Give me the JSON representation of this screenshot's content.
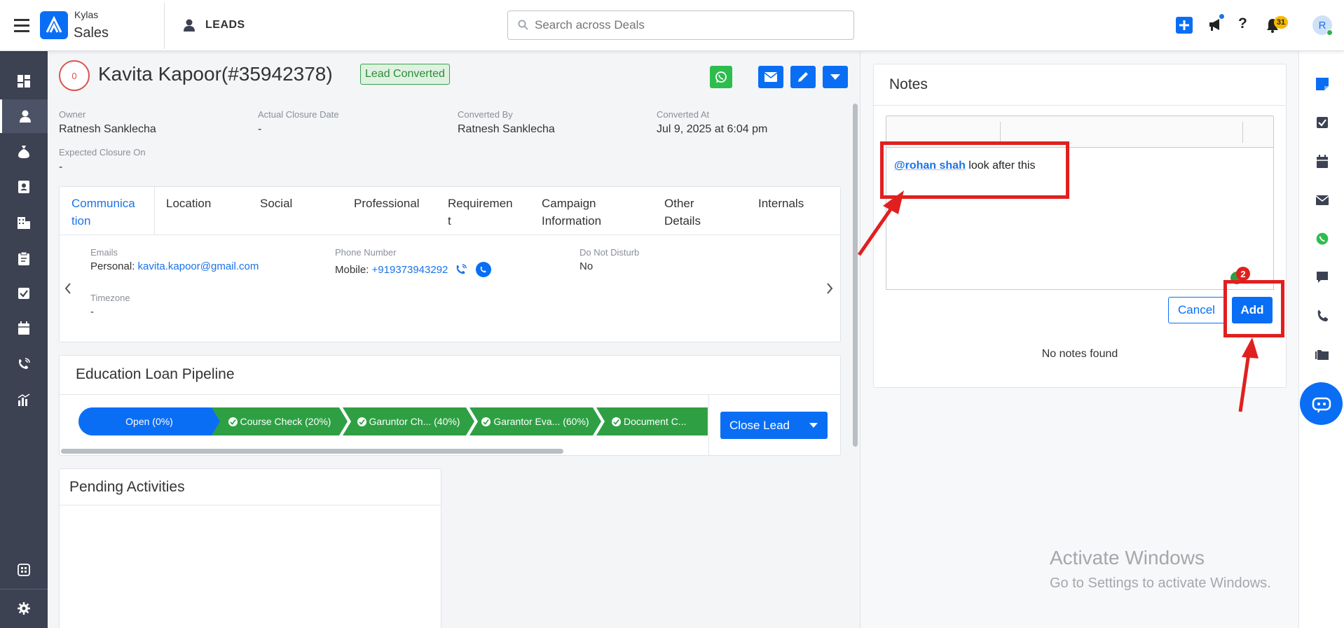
{
  "app": {
    "brand_top": "Kylas",
    "brand_bottom": "Sales",
    "module": "LEADS"
  },
  "search": {
    "placeholder": "Search across Deals"
  },
  "header": {
    "notification_count": "31",
    "avatar_initial": "R"
  },
  "lead": {
    "score": "0",
    "name": "Kavita Kapoor(#35942378)",
    "status": "Lead Converted"
  },
  "fields": [
    {
      "label": "Owner",
      "value": "Ratnesh Sanklecha"
    },
    {
      "label": "Actual Closure Date",
      "value": "-"
    },
    {
      "label": "Converted By",
      "value": "Ratnesh Sanklecha"
    },
    {
      "label": "Converted At",
      "value": "Jul 9, 2025 at 6:04 pm"
    },
    {
      "label": "Expected Closure On",
      "value": "-"
    }
  ],
  "tabs": [
    {
      "l1": "Communica",
      "l2": "tion"
    },
    {
      "l1": "Location",
      "l2": ""
    },
    {
      "l1": "Social",
      "l2": ""
    },
    {
      "l1": "Professional",
      "l2": ""
    },
    {
      "l1": "Requiremen",
      "l2": "t"
    },
    {
      "l1": "Campaign",
      "l2": "Information"
    },
    {
      "l1": "Other",
      "l2": "Details"
    },
    {
      "l1": "Internals",
      "l2": ""
    }
  ],
  "comm": {
    "emails_label": "Emails",
    "email_prefix": "Personal:",
    "email": "kavita.kapoor@gmail.com",
    "phone_label": "Phone Number",
    "phone_prefix": "Mobile:",
    "phone": "+919373943292",
    "dnd_label": "Do Not Disturb",
    "dnd": "No",
    "tz_label": "Timezone",
    "tz": "-"
  },
  "pipeline": {
    "title": "Education Loan Pipeline",
    "stages": [
      "Open (0%)",
      "Course Check (20%)",
      "Garuntor Ch...  (40%)",
      "Garantor Eva... (60%)",
      "Document C..."
    ],
    "close_label": "Close Lead"
  },
  "pending": {
    "title": "Pending Activities"
  },
  "notes": {
    "title": "Notes",
    "block_style": "Paragraph",
    "mention": "@rohan shah",
    "text": " look after this",
    "cancel": "Cancel",
    "add": "Add",
    "empty": "No notes found",
    "badge": "2"
  },
  "watermark": {
    "l1": "Activate Windows",
    "l2": "Go to Settings to activate Windows."
  }
}
